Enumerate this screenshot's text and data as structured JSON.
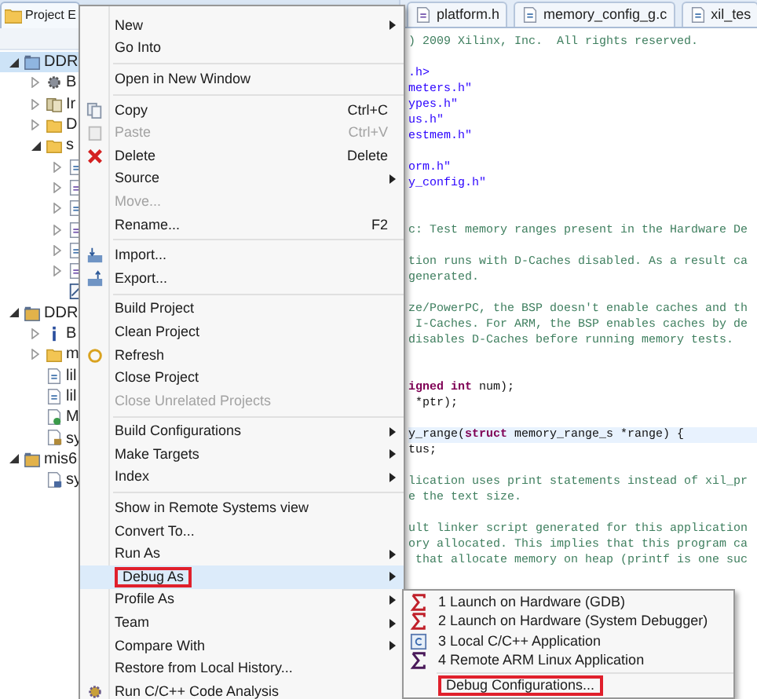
{
  "explorer": {
    "title": "Project E",
    "tree": [
      {
        "label": "DDR",
        "kind": "project",
        "expanded": true,
        "selected": true,
        "children": [
          {
            "label": "B",
            "kind": "binaries",
            "expanded": false,
            "selected": false
          },
          {
            "label": "Ir",
            "kind": "includes",
            "expanded": false,
            "selected": false
          },
          {
            "label": "D",
            "kind": "folder",
            "expanded": false,
            "selected": false
          },
          {
            "label": "s",
            "kind": "folder",
            "expanded": true,
            "selected": false,
            "children": [
              {
                "kind": "source",
                "expanded": false,
                "selected": false
              },
              {
                "kind": "header",
                "expanded": false,
                "selected": false
              },
              {
                "kind": "source",
                "expanded": false,
                "selected": false
              },
              {
                "kind": "header",
                "expanded": false,
                "selected": false
              },
              {
                "kind": "source",
                "expanded": false,
                "selected": false
              },
              {
                "kind": "header",
                "expanded": false,
                "selected": false
              },
              {
                "kind": "script",
                "selected": false
              }
            ]
          }
        ]
      },
      {
        "label": "DDR",
        "kind": "bsp",
        "expanded": true,
        "selected": false,
        "children": [
          {
            "label": "B",
            "kind": "info",
            "expanded": false,
            "selected": false
          },
          {
            "label": "m",
            "kind": "folder",
            "expanded": false,
            "selected": false
          },
          {
            "label": "lil",
            "kind": "doc",
            "selected": false
          },
          {
            "label": "lil",
            "kind": "doc",
            "selected": false
          },
          {
            "label": "M",
            "kind": "make",
            "selected": false
          },
          {
            "label": "sy",
            "kind": "settings",
            "selected": false
          }
        ]
      },
      {
        "label": "mis6",
        "kind": "bsp",
        "expanded": true,
        "selected": false,
        "children": [
          {
            "label": "sy",
            "kind": "hw",
            "selected": false
          }
        ]
      }
    ]
  },
  "editor": {
    "tabs": [
      {
        "label": "platform.h",
        "kind": "header"
      },
      {
        "label": "memory_config_g.c",
        "kind": "source"
      },
      {
        "label": "xil_tes",
        "kind": "source"
      }
    ],
    "lines": [
      {
        "kind": "comment",
        "text": ") 2009 Xilinx, Inc.  All rights reserved."
      },
      {
        "kind": "blank"
      },
      {
        "kind": "string",
        "text": ".h>"
      },
      {
        "kind": "string",
        "text": "meters.h\""
      },
      {
        "kind": "string",
        "text": "ypes.h\""
      },
      {
        "kind": "string",
        "text": "us.h\""
      },
      {
        "kind": "string",
        "text": "estmem.h\""
      },
      {
        "kind": "blank"
      },
      {
        "kind": "string",
        "text": "orm.h\""
      },
      {
        "kind": "string",
        "text": "y_config.h\""
      },
      {
        "kind": "blank"
      },
      {
        "kind": "blank"
      },
      {
        "kind": "comment",
        "text": "c: Test memory ranges present in the Hardware De"
      },
      {
        "kind": "blank"
      },
      {
        "kind": "comment",
        "text": "tion runs with D-Caches disabled. As a result ca"
      },
      {
        "kind": "comment",
        "text": "generated."
      },
      {
        "kind": "blank"
      },
      {
        "kind": "comment",
        "text": "ze/PowerPC, the BSP doesn't enable caches and th"
      },
      {
        "kind": "comment",
        "text": " I-Caches. For ARM, the BSP enables caches by de"
      },
      {
        "kind": "comment",
        "text": "disables D-Caches before running memory tests."
      },
      {
        "kind": "blank"
      },
      {
        "kind": "blank"
      },
      {
        "kind": "code",
        "segments": [
          {
            "kind": "keyword",
            "text": "igned int"
          },
          {
            "kind": "plain",
            "text": " num);"
          }
        ]
      },
      {
        "kind": "code",
        "segments": [
          {
            "kind": "plain",
            "text": " *ptr);"
          }
        ]
      },
      {
        "kind": "blank"
      },
      {
        "kind": "code",
        "current": true,
        "segments": [
          {
            "kind": "plain",
            "text": "y_range("
          },
          {
            "kind": "keyword",
            "text": "struct"
          },
          {
            "kind": "plain",
            "text": " memory_range_s *range) {"
          }
        ]
      },
      {
        "kind": "code",
        "segments": [
          {
            "kind": "plain",
            "text": "tus;"
          }
        ]
      },
      {
        "kind": "blank"
      },
      {
        "kind": "comment",
        "text": "lication uses print statements instead of xil_pr"
      },
      {
        "kind": "comment",
        "text": "e the text size."
      },
      {
        "kind": "blank"
      },
      {
        "kind": "comment",
        "text": "ult linker script generated for this application"
      },
      {
        "kind": "comment",
        "text": "ory allocated. This implies that this program ca"
      },
      {
        "kind": "comment",
        "text": " that allocate memory on heap (printf is one suc"
      }
    ]
  },
  "context_menu": [
    {
      "kind": "item",
      "label": "New",
      "submenu": true,
      "disabled": false,
      "selected": false,
      "outlined": false
    },
    {
      "kind": "item",
      "label": "Go Into",
      "submenu": false,
      "disabled": false,
      "selected": false,
      "outlined": false
    },
    {
      "kind": "separator"
    },
    {
      "kind": "item",
      "label": "Open in New Window",
      "submenu": false,
      "disabled": false,
      "selected": false,
      "outlined": false
    },
    {
      "kind": "separator"
    },
    {
      "kind": "copy",
      "label": "Copy",
      "shortcut": "Ctrl+C",
      "submenu": false,
      "disabled": false,
      "selected": false,
      "outlined": false
    },
    {
      "kind": "paste",
      "label": "Paste",
      "shortcut": "Ctrl+V",
      "submenu": false,
      "disabled": true,
      "selected": false,
      "outlined": false
    },
    {
      "kind": "delete",
      "label": "Delete",
      "shortcut": "Delete",
      "submenu": false,
      "disabled": false,
      "selected": false,
      "outlined": false
    },
    {
      "kind": "item",
      "label": "Source",
      "submenu": true,
      "disabled": false,
      "selected": false,
      "outlined": false
    },
    {
      "kind": "item",
      "label": "Move...",
      "submenu": false,
      "disabled": true,
      "selected": false,
      "outlined": false
    },
    {
      "kind": "item",
      "label": "Rename...",
      "shortcut": "F2",
      "submenu": false,
      "disabled": false,
      "selected": false,
      "outlined": false
    },
    {
      "kind": "separator"
    },
    {
      "kind": "import",
      "label": "Import...",
      "submenu": false,
      "disabled": false,
      "selected": false,
      "outlined": false
    },
    {
      "kind": "export",
      "label": "Export...",
      "submenu": false,
      "disabled": false,
      "selected": false,
      "outlined": false
    },
    {
      "kind": "separator"
    },
    {
      "kind": "item",
      "label": "Build Project",
      "submenu": false,
      "disabled": false,
      "selected": false,
      "outlined": false
    },
    {
      "kind": "item",
      "label": "Clean Project",
      "submenu": false,
      "disabled": false,
      "selected": false,
      "outlined": false
    },
    {
      "kind": "refresh",
      "label": "Refresh",
      "submenu": false,
      "disabled": false,
      "selected": false,
      "outlined": false
    },
    {
      "kind": "item",
      "label": "Close Project",
      "submenu": false,
      "disabled": false,
      "selected": false,
      "outlined": false
    },
    {
      "kind": "item",
      "label": "Close Unrelated Projects",
      "submenu": false,
      "disabled": true,
      "selected": false,
      "outlined": false
    },
    {
      "kind": "separator"
    },
    {
      "kind": "item",
      "label": "Build Configurations",
      "submenu": true,
      "disabled": false,
      "selected": false,
      "outlined": false
    },
    {
      "kind": "item",
      "label": "Make Targets",
      "submenu": true,
      "disabled": false,
      "selected": false,
      "outlined": false
    },
    {
      "kind": "item",
      "label": "Index",
      "submenu": true,
      "disabled": false,
      "selected": false,
      "outlined": false
    },
    {
      "kind": "separator"
    },
    {
      "kind": "item",
      "label": "Show in Remote Systems view",
      "submenu": false,
      "disabled": false,
      "selected": false,
      "outlined": false
    },
    {
      "kind": "item",
      "label": "Convert To...",
      "submenu": false,
      "disabled": false,
      "selected": false,
      "outlined": false
    },
    {
      "kind": "item",
      "label": "Run As",
      "submenu": true,
      "disabled": false,
      "selected": false,
      "outlined": false
    },
    {
      "kind": "item",
      "label": "Debug As",
      "submenu": true,
      "disabled": false,
      "selected": true,
      "outlined": true
    },
    {
      "kind": "item",
      "label": "Profile As",
      "submenu": true,
      "disabled": false,
      "selected": false,
      "outlined": false
    },
    {
      "kind": "item",
      "label": "Team",
      "submenu": true,
      "disabled": false,
      "selected": false,
      "outlined": false
    },
    {
      "kind": "item",
      "label": "Compare With",
      "submenu": true,
      "disabled": false,
      "selected": false,
      "outlined": false
    },
    {
      "kind": "item",
      "label": "Restore from Local History...",
      "submenu": false,
      "disabled": false,
      "selected": false,
      "outlined": false
    },
    {
      "kind": "analysis",
      "label": "Run C/C++ Code Analysis",
      "submenu": false,
      "disabled": false,
      "selected": false,
      "outlined": false
    }
  ],
  "submenu": [
    {
      "kind": "gdb",
      "label": "1 Launch on Hardware (GDB)",
      "outlined": false
    },
    {
      "kind": "tcf",
      "label": "2 Launch on Hardware (System Debugger)",
      "outlined": false
    },
    {
      "kind": "app",
      "label": "3 Local C/C++ Application",
      "outlined": false
    },
    {
      "kind": "remote",
      "label": "4 Remote ARM Linux Application",
      "outlined": false
    },
    {
      "kind": "separator"
    },
    {
      "kind": "item",
      "label": "Debug Configurations...",
      "outlined": true
    }
  ]
}
